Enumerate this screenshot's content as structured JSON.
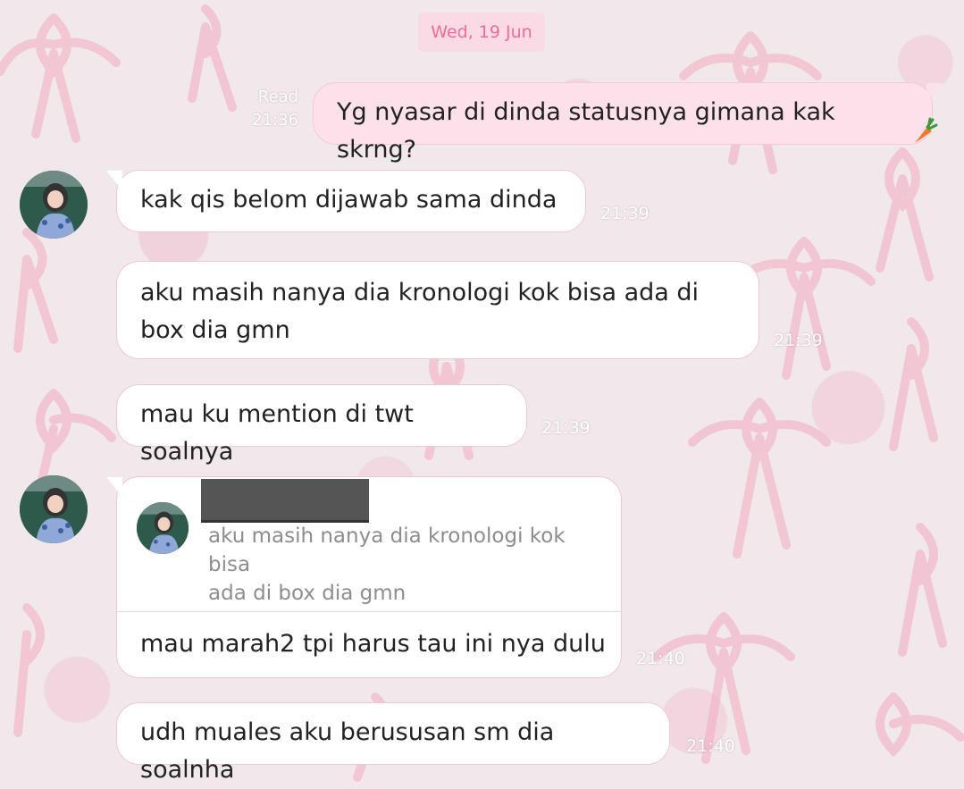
{
  "header": {
    "date": "Wed, 19 Jun"
  },
  "messages": [
    {
      "direction": "out",
      "text": "Yg nyasar di dinda statusnya gimana kak skrng?",
      "status": "Read",
      "time": "21:36"
    },
    {
      "direction": "in",
      "text": "kak qis belom dijawab sama dinda",
      "time": "21:39"
    },
    {
      "direction": "in",
      "text_line1": "aku masih nanya dia kronologi kok bisa ada di",
      "text_line2": "box dia gmn",
      "time": "21:39"
    },
    {
      "direction": "in",
      "text": "mau ku mention di twt soalnya",
      "time": "21:39"
    },
    {
      "direction": "in",
      "reply_quote_line1": "aku masih nanya dia kronologi kok bisa",
      "reply_quote_line2": "ada di box dia gmn",
      "text": "mau marah2 tpi harus tau ini nya dulu",
      "time": "21:40"
    },
    {
      "direction": "in",
      "text": "udh muales aku berususan sm dia soalnha",
      "time": "21:40"
    }
  ],
  "icons": {
    "sticker": "carrot-icon",
    "avatar": "profile-avatar"
  },
  "colors": {
    "background": "#f1e8ec",
    "outgoing_bubble": "#fde1ea",
    "incoming_bubble": "#ffffff",
    "date_text": "#f06c95"
  }
}
